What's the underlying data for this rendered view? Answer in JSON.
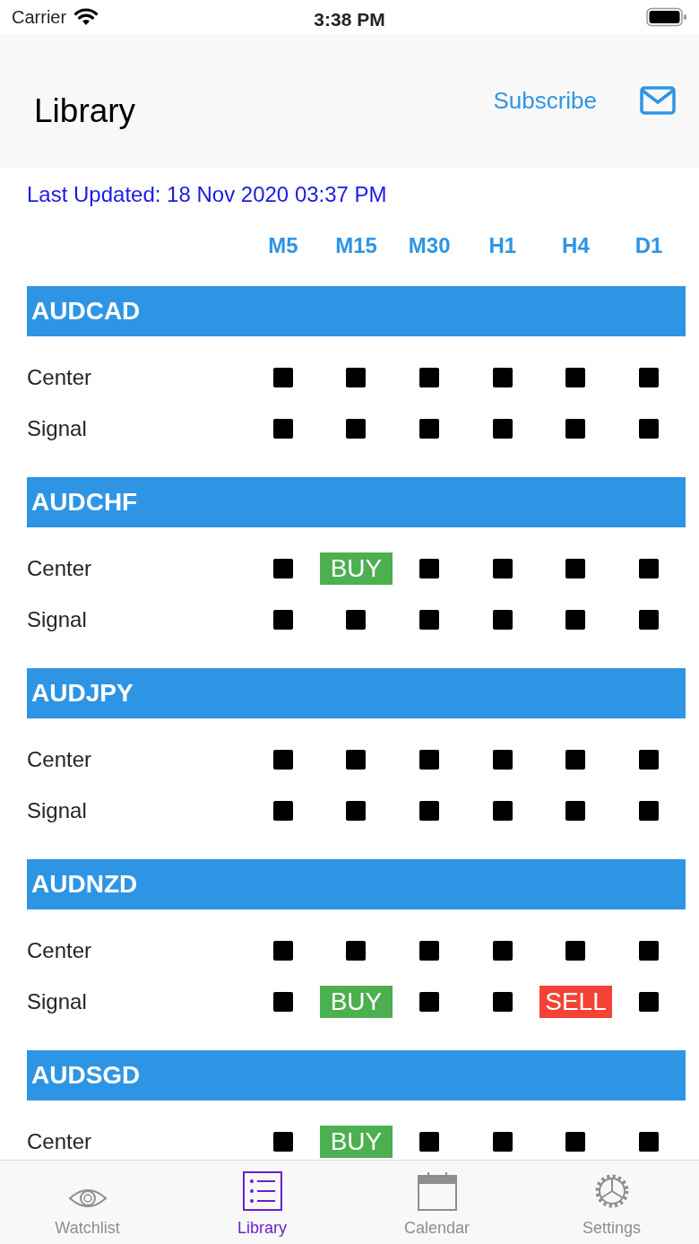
{
  "status_bar": {
    "carrier": "Carrier",
    "time": "3:38 PM"
  },
  "nav_bar": {
    "title": "Library",
    "subscribe": "Subscribe"
  },
  "last_updated": "Last Updated: 18 Nov 2020 03:37 PM",
  "timeframes": [
    "M5",
    "M15",
    "M30",
    "H1",
    "H4",
    "D1"
  ],
  "pairs": [
    {
      "name": "AUDCAD",
      "rows": [
        {
          "label": "Center",
          "cells": [
            {
              "kind": "none"
            },
            {
              "kind": "none"
            },
            {
              "kind": "none"
            },
            {
              "kind": "none"
            },
            {
              "kind": "none"
            },
            {
              "kind": "none"
            }
          ]
        },
        {
          "label": "Signal",
          "cells": [
            {
              "kind": "none"
            },
            {
              "kind": "none"
            },
            {
              "kind": "none"
            },
            {
              "kind": "none"
            },
            {
              "kind": "none"
            },
            {
              "kind": "none"
            }
          ]
        }
      ]
    },
    {
      "name": "AUDCHF",
      "rows": [
        {
          "label": "Center",
          "cells": [
            {
              "kind": "none"
            },
            {
              "kind": "buy",
              "text": "BUY"
            },
            {
              "kind": "none"
            },
            {
              "kind": "none"
            },
            {
              "kind": "none"
            },
            {
              "kind": "none"
            }
          ]
        },
        {
          "label": "Signal",
          "cells": [
            {
              "kind": "none"
            },
            {
              "kind": "none"
            },
            {
              "kind": "none"
            },
            {
              "kind": "none"
            },
            {
              "kind": "none"
            },
            {
              "kind": "none"
            }
          ]
        }
      ]
    },
    {
      "name": "AUDJPY",
      "rows": [
        {
          "label": "Center",
          "cells": [
            {
              "kind": "none"
            },
            {
              "kind": "none"
            },
            {
              "kind": "none"
            },
            {
              "kind": "none"
            },
            {
              "kind": "none"
            },
            {
              "kind": "none"
            }
          ]
        },
        {
          "label": "Signal",
          "cells": [
            {
              "kind": "none"
            },
            {
              "kind": "none"
            },
            {
              "kind": "none"
            },
            {
              "kind": "none"
            },
            {
              "kind": "none"
            },
            {
              "kind": "none"
            }
          ]
        }
      ]
    },
    {
      "name": "AUDNZD",
      "rows": [
        {
          "label": "Center",
          "cells": [
            {
              "kind": "none"
            },
            {
              "kind": "none"
            },
            {
              "kind": "none"
            },
            {
              "kind": "none"
            },
            {
              "kind": "none"
            },
            {
              "kind": "none"
            }
          ]
        },
        {
          "label": "Signal",
          "cells": [
            {
              "kind": "none"
            },
            {
              "kind": "buy",
              "text": "BUY"
            },
            {
              "kind": "none"
            },
            {
              "kind": "none"
            },
            {
              "kind": "sell",
              "text": "SELL"
            },
            {
              "kind": "none"
            }
          ]
        }
      ]
    },
    {
      "name": "AUDSGD",
      "rows": [
        {
          "label": "Center",
          "cells": [
            {
              "kind": "none"
            },
            {
              "kind": "buy",
              "text": "BUY"
            },
            {
              "kind": "none"
            },
            {
              "kind": "none"
            },
            {
              "kind": "none"
            },
            {
              "kind": "none"
            }
          ]
        }
      ]
    }
  ],
  "tab_bar": [
    {
      "label": "Watchlist",
      "selected": false
    },
    {
      "label": "Library",
      "selected": true
    },
    {
      "label": "Calendar",
      "selected": false
    },
    {
      "label": "Settings",
      "selected": false
    }
  ]
}
